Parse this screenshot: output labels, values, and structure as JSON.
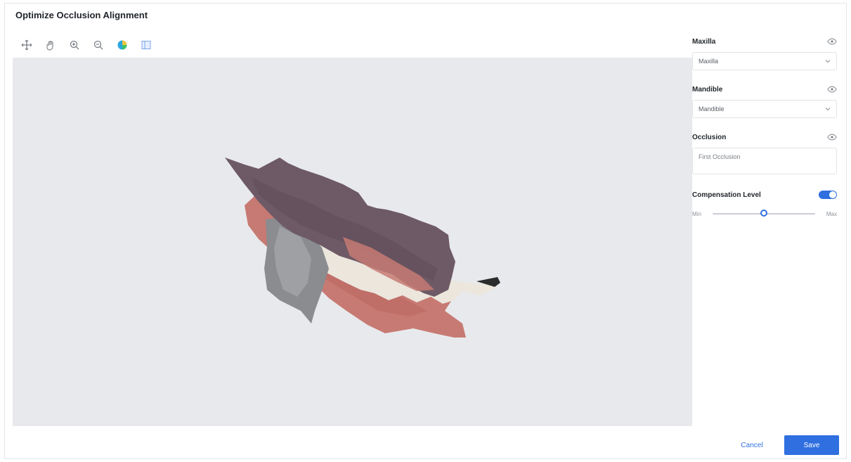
{
  "dialog": {
    "title": "Optimize Occlusion Alignment"
  },
  "toolbar": {
    "tools": [
      {
        "name": "move-icon"
      },
      {
        "name": "pan-hand-icon"
      },
      {
        "name": "zoom-in-icon"
      },
      {
        "name": "zoom-out-icon"
      },
      {
        "name": "color-map-icon"
      },
      {
        "name": "view-layout-icon"
      }
    ]
  },
  "panel": {
    "maxilla": {
      "label": "Maxilla",
      "selected": "Maxilla"
    },
    "mandible": {
      "label": "Mandible",
      "selected": "Mandible"
    },
    "occlusion": {
      "label": "Occlusion",
      "value": "First Occlusion"
    },
    "compensation": {
      "label": "Compensation Level",
      "min_label": "Min",
      "max_label": "Max",
      "level": 0.5,
      "enabled": true
    }
  },
  "actions": {
    "cancel_label": "Cancel",
    "save_label": "Save"
  },
  "colors": {
    "accent": "#2f6fe0",
    "viewport_bg": "#e8e9ec",
    "maxilla_model": "#6e5a66",
    "gingiva": "#c77a73",
    "teeth": "#ece6dd",
    "occlusion_model": "#8a8c8f"
  }
}
